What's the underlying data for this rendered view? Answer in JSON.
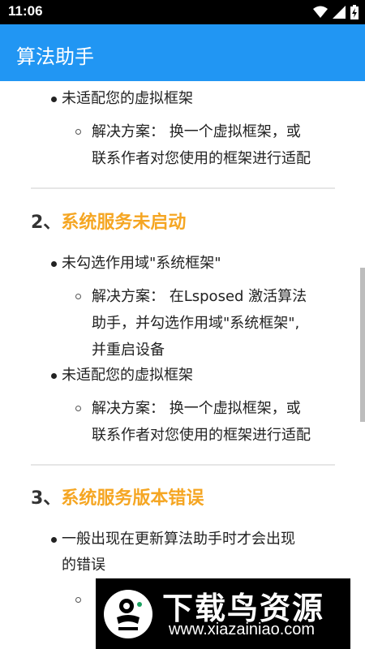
{
  "status_bar": {
    "time": "11:06"
  },
  "app_bar": {
    "title": "算法助手"
  },
  "content": {
    "top_item": "未适配您的虚拟框架",
    "top_solution": [
      "解决方案： 换一个虚拟框架，或",
      "联系作者对您使用的框架进行适配"
    ],
    "section2": {
      "number": "2、",
      "title": "系统服务未启动",
      "item1": "未勾选作用域\"系统框架\"",
      "item1_solution": [
        "解决方案： 在Lsposed 激活算法",
        "助手，并勾选作用域\"系统框架\",",
        "并重启设备"
      ],
      "item2": "未适配您的虚拟框架",
      "item2_solution": [
        "解决方案： 换一个虚拟框架，或",
        "联系作者对您使用的框架进行适配"
      ]
    },
    "section3": {
      "number": "3、",
      "title": "系统服务版本错误",
      "item1": [
        "一般出现在更新算法助手时才会出现",
        "的错误"
      ]
    }
  },
  "watermark": {
    "name": "下载鸟资源",
    "url": "www.xiazainiao.com"
  }
}
